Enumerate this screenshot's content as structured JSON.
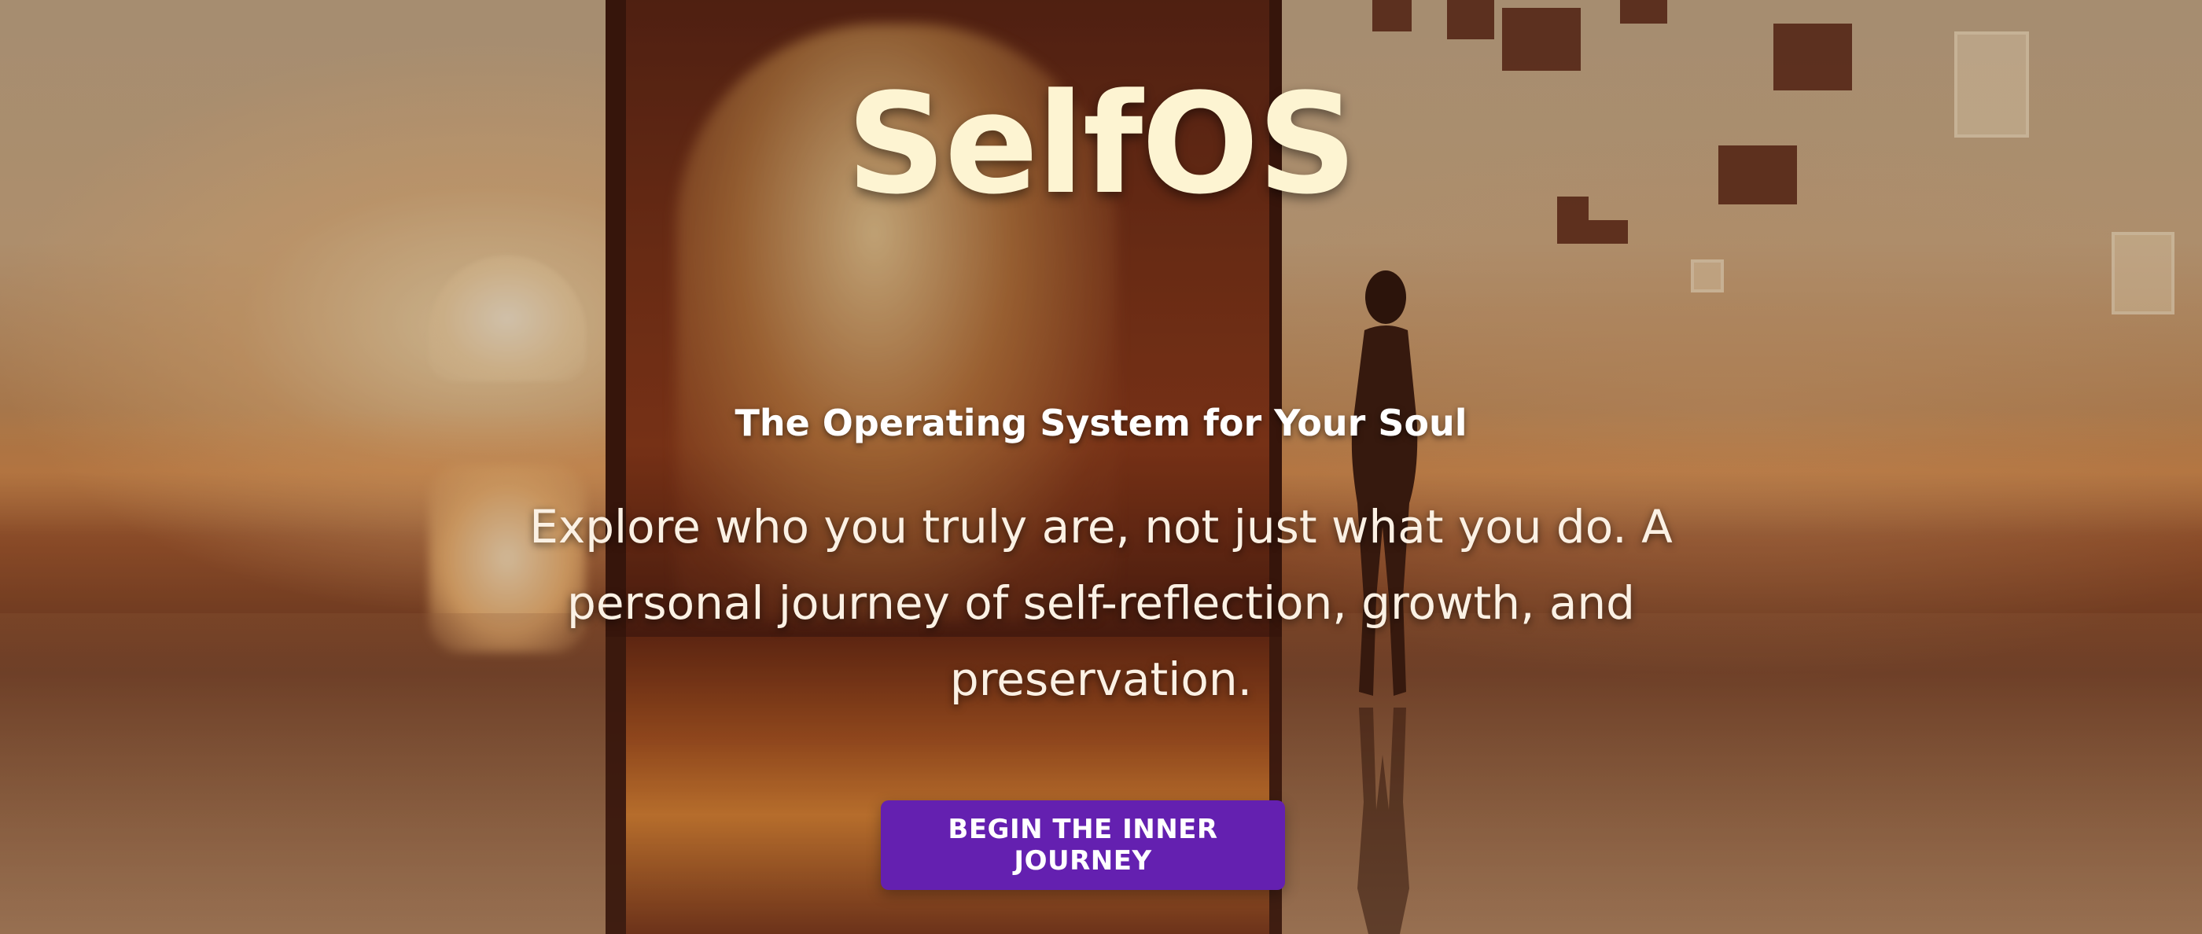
{
  "hero": {
    "brand_name": "SelfOS",
    "tagline": "The Operating System for Your Soul",
    "description": "Explore who you truly are, not just what you do. A personal journey of self-reflection, growth, and preservation.",
    "cta_label": "BEGIN THE INNER JOURNEY"
  },
  "colors": {
    "brand_text": "#fdf4d2",
    "cta_background": "#6420b0",
    "cta_text": "#ffffff"
  }
}
